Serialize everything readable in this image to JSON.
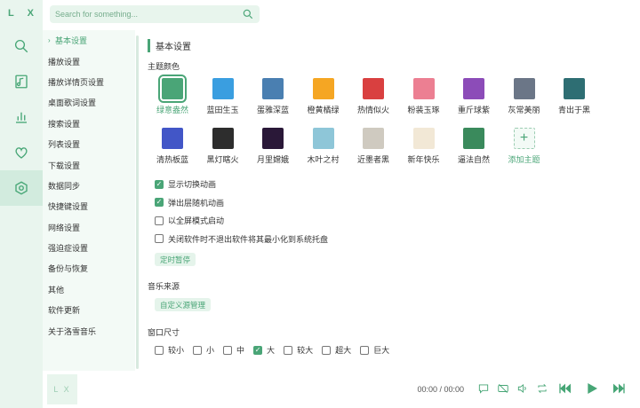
{
  "app": {
    "logo": "L X"
  },
  "search": {
    "placeholder": "Search for something..."
  },
  "nav": {
    "items": [
      {
        "label": "基本设置",
        "active": true
      },
      {
        "label": "播放设置"
      },
      {
        "label": "播放详情页设置"
      },
      {
        "label": "桌面歌词设置"
      },
      {
        "label": "搜索设置"
      },
      {
        "label": "列表设置"
      },
      {
        "label": "下载设置"
      },
      {
        "label": "数据同步"
      },
      {
        "label": "快捷键设置"
      },
      {
        "label": "网络设置"
      },
      {
        "label": "强迫症设置"
      },
      {
        "label": "备份与恢复"
      },
      {
        "label": "其他"
      },
      {
        "label": "软件更新"
      },
      {
        "label": "关于洛雪音乐"
      }
    ]
  },
  "basic": {
    "section_title": "基本设置",
    "theme_label": "主题颜色",
    "themes_row1": [
      {
        "name": "绿意盎然",
        "color": "#4aa577",
        "selected": true
      },
      {
        "name": "蓝田生玉",
        "color": "#3a9ee0"
      },
      {
        "name": "蛋雅深蓝",
        "color": "#4a7fb1"
      },
      {
        "name": "橙黄橘绿",
        "color": "#f5a623"
      },
      {
        "name": "热情似火",
        "color": "#d94040"
      },
      {
        "name": "粉装玉琢",
        "color": "#ec7f92"
      },
      {
        "name": "重斤球紫",
        "color": "#8c4cb8"
      },
      {
        "name": "灰常美丽",
        "color": "#6b7687"
      },
      {
        "name": "青出于黑",
        "color": "#2e6e73"
      }
    ],
    "themes_row2": [
      {
        "name": "清热板蓝",
        "color": "#4256c7"
      },
      {
        "name": "黑灯瞎火",
        "color": "#2d2d2d"
      },
      {
        "name": "月里嫦娥",
        "color": "#2a1838"
      },
      {
        "name": "木叶之村",
        "color": "#8ec6d8"
      },
      {
        "name": "近墨者黑",
        "color": "#cfcac0"
      },
      {
        "name": "新年快乐",
        "color": "#f2e8d6"
      },
      {
        "name": "逼法自然",
        "color": "#3a8a5c"
      },
      {
        "name": "添加主题",
        "color": "#f3faf6",
        "add": true
      }
    ],
    "options": [
      {
        "label": "显示切换动画",
        "checked": true
      },
      {
        "label": "弹出层随机动画",
        "checked": true
      },
      {
        "label": "以全屏模式启动",
        "checked": false
      },
      {
        "label": "关闭软件时不退出软件将其最小化到系统托盘",
        "checked": false
      }
    ],
    "timer_button": "定时暂停",
    "source_label": "音乐来源",
    "source_button": "自定义源管理",
    "window_size_label": "窗口尺寸",
    "window_sizes": [
      {
        "label": "较小",
        "checked": false
      },
      {
        "label": "小",
        "checked": false
      },
      {
        "label": "中",
        "checked": false
      },
      {
        "label": "大",
        "checked": true
      },
      {
        "label": "较大",
        "checked": false
      },
      {
        "label": "超大",
        "checked": false
      },
      {
        "label": "巨大",
        "checked": false
      }
    ]
  },
  "player": {
    "cover_text": "L X",
    "time": "00:00 / 00:00"
  },
  "colors": {
    "accent": "#4aa577",
    "rail_bg": "#e9f5ee"
  }
}
